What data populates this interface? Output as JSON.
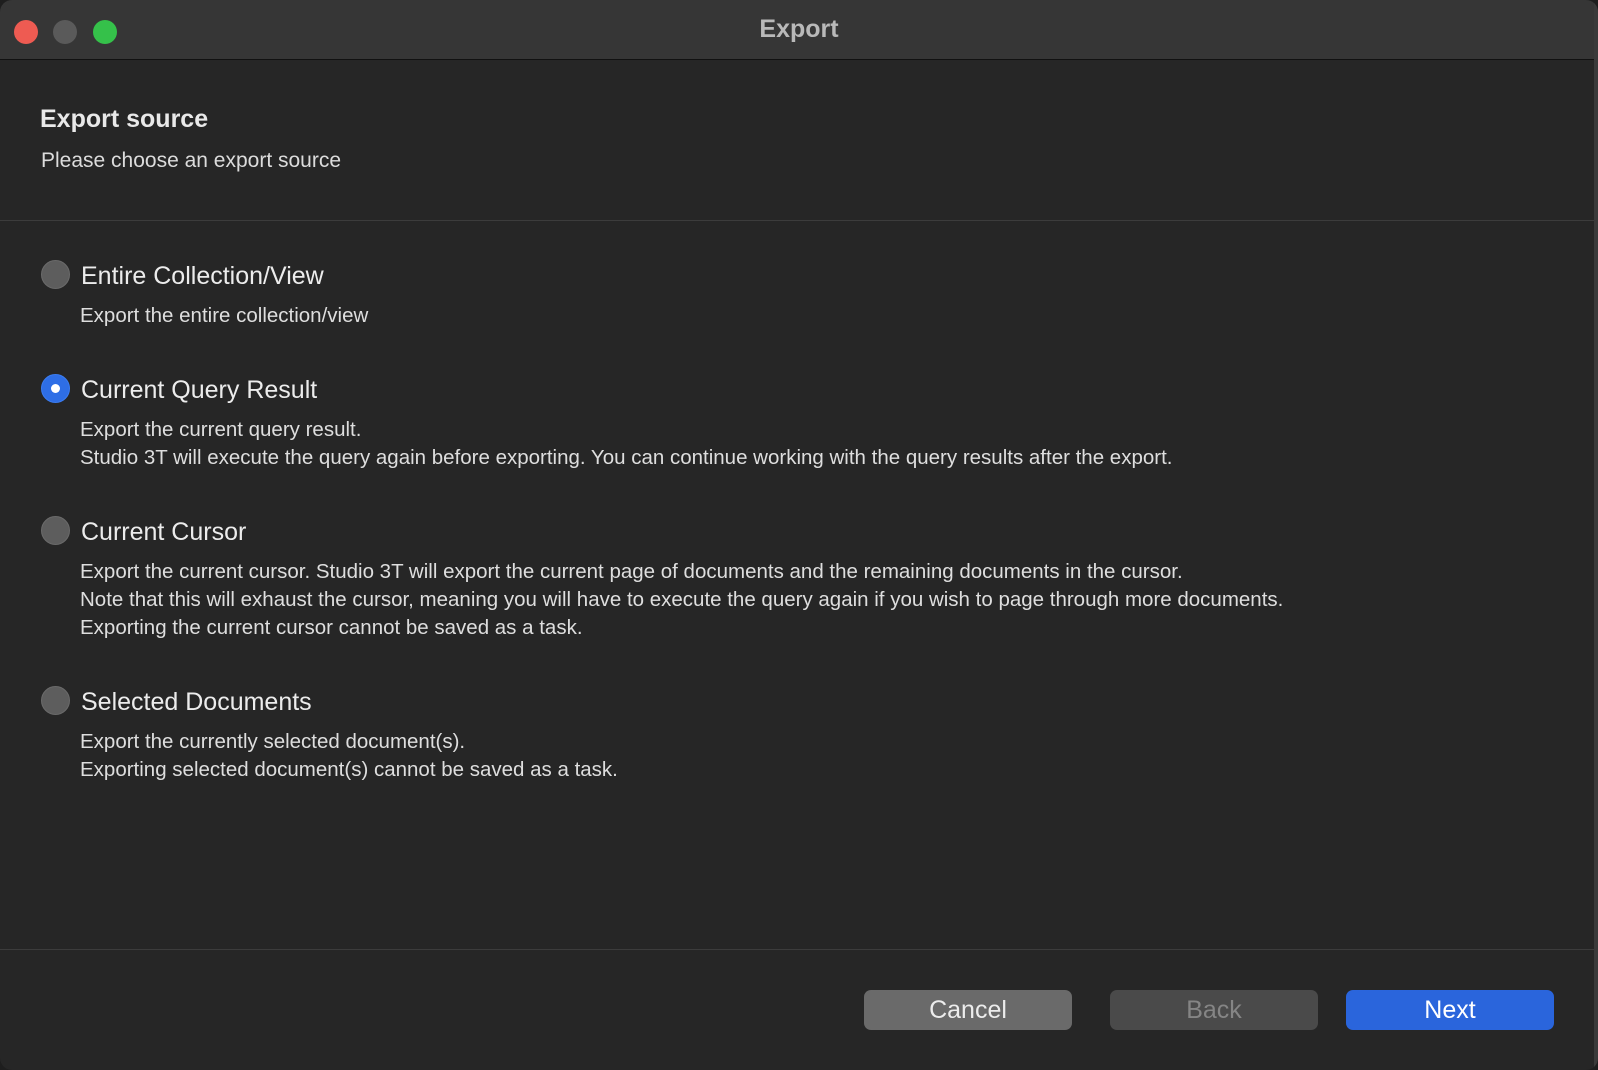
{
  "window": {
    "title": "Export"
  },
  "header": {
    "title": "Export source",
    "subtitle": "Please choose an export source"
  },
  "options": [
    {
      "label": "Entire Collection/View",
      "selected": false,
      "description": [
        "Export the entire collection/view"
      ]
    },
    {
      "label": "Current Query Result",
      "selected": true,
      "description": [
        "Export the current query result.",
        "Studio 3T will execute the query again before exporting. You can continue working with the query results after the export."
      ]
    },
    {
      "label": "Current Cursor",
      "selected": false,
      "description": [
        "Export the current cursor. Studio 3T will export the current page of documents and the remaining documents in the cursor.",
        "Note that this will exhaust the cursor, meaning you will have to execute the query again if you wish to page through more documents.",
        "Exporting the current cursor cannot be saved as a task."
      ]
    },
    {
      "label": "Selected Documents",
      "selected": false,
      "description": [
        "Export the currently selected document(s).",
        "Exporting selected document(s) cannot be saved as a task."
      ]
    }
  ],
  "footer": {
    "cancel_label": "Cancel",
    "back_label": "Back",
    "back_enabled": false,
    "next_label": "Next"
  },
  "colors": {
    "accent": "#2a65dc",
    "background": "#262626",
    "titlebar": "#363636"
  }
}
